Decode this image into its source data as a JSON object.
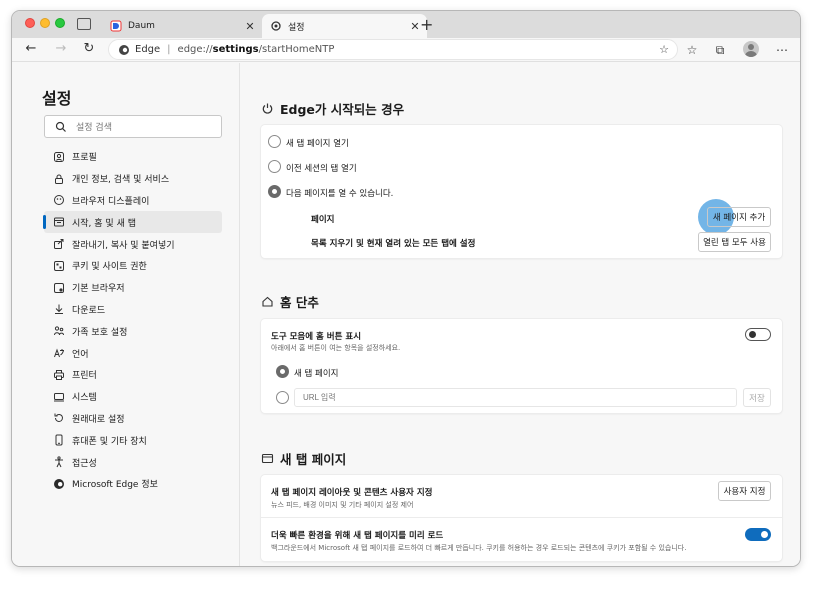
{
  "browser": {
    "tabs": [
      {
        "title": "Daum",
        "close": "✕"
      },
      {
        "title": "설정",
        "close": "✕"
      }
    ],
    "new_tab": "+",
    "address": {
      "site": "Edge",
      "separator": "|",
      "url_prefix": "edge://",
      "url_bold": "settings",
      "url_suffix": "/startHomeNTP"
    }
  },
  "sidebar": {
    "title": "설정",
    "search_placeholder": "설정 검색",
    "items": [
      {
        "label": "프로필",
        "icon": "profile-icon"
      },
      {
        "label": "개인 정보, 검색 및 서비스",
        "icon": "lock-icon"
      },
      {
        "label": "브라우저 디스플레이",
        "icon": "paint-icon"
      },
      {
        "label": "시작, 홈 및 새 탭",
        "icon": "home-tab-icon",
        "active": true
      },
      {
        "label": "잘라내기, 복사 및 붙여넣기",
        "icon": "share-icon"
      },
      {
        "label": "쿠키 및 사이트 권한",
        "icon": "cookie-icon"
      },
      {
        "label": "기본 브라우저",
        "icon": "browser-icon"
      },
      {
        "label": "다운로드",
        "icon": "download-icon"
      },
      {
        "label": "가족 보호 설정",
        "icon": "family-icon"
      },
      {
        "label": "언어",
        "icon": "language-icon"
      },
      {
        "label": "프린터",
        "icon": "printer-icon"
      },
      {
        "label": "시스템",
        "icon": "system-icon"
      },
      {
        "label": "원래대로 설정",
        "icon": "reset-icon"
      },
      {
        "label": "휴대폰 및 기타 장치",
        "icon": "phone-icon"
      },
      {
        "label": "접근성",
        "icon": "accessibility-icon"
      },
      {
        "label": "Microsoft Edge 정보",
        "icon": "edge-icon"
      }
    ]
  },
  "startup": {
    "title": "Edge가 시작되는 경우",
    "options": [
      "새 탭 페이지 열기",
      "이전 세션의 탭 열기",
      "다음 페이지를 열 수 있습니다."
    ],
    "selected_index": 2,
    "pages_label": "페이지",
    "add_page_button": "새 페이지 추가",
    "clear_label": "목록 지우기 및 현재 열려 있는 모든 탭에 설정",
    "use_all_tabs_button": "열린 탭 모두 사용"
  },
  "home": {
    "title": "홈 단추",
    "show_label": "도구 모음에 홈 버튼 표시",
    "show_desc": "아래에서 홈 버튼이 여는 항목을 설정하세요.",
    "show_toggle": false,
    "new_tab_option": "새 탭 페이지",
    "url_placeholder": "URL 입력",
    "save_button": "저장"
  },
  "newtab": {
    "title": "새 탭 페이지",
    "customize_label": "새 탭 페이지 레이아웃 및 콘텐츠 사용자 지정",
    "customize_desc": "뉴스 피드, 배경 이미지 및 기타 페이지 설정 제어",
    "customize_button": "사용자 지정",
    "preload_label": "더욱 빠른 환경을 위해 새 탭 페이지를 미리 로드",
    "preload_desc": "백그라운드에서 Microsoft 새 탭 페이지를 로드하여 더 빠르게 만듭니다. 쿠키를 허용하는 경우 로드되는 콘텐츠에 쿠키가 포함될 수 있습니다.",
    "preload_toggle": true
  },
  "colors": {
    "accent": "#0f6cbd",
    "highlight": "#0078d4"
  }
}
